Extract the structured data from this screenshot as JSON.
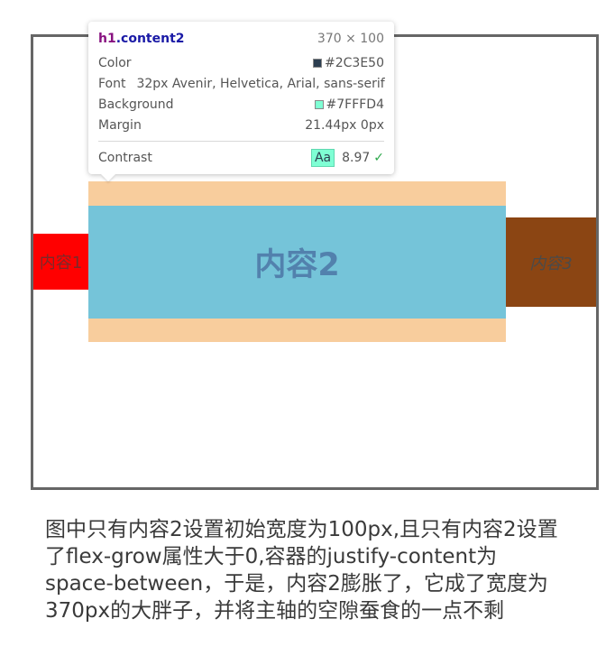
{
  "demo": {
    "item1": {
      "label": "内容1",
      "background": "#FF0000"
    },
    "item2": {
      "label": "内容2",
      "background": "#75C4D9",
      "margin_color": "#F8CD9D"
    },
    "item3": {
      "label": "内容3",
      "background": "#8B4513"
    }
  },
  "tooltip": {
    "selector_tag": "h1",
    "selector_class": ".content2",
    "dimensions": "370 × 100",
    "rows": {
      "color": {
        "label": "Color",
        "value": "#2C3E50",
        "swatch": "#2C3E50"
      },
      "font": {
        "label": "Font",
        "value": "32px Avenir, Helvetica, Arial, sans-serif"
      },
      "background": {
        "label": "Background",
        "value": "#7FFFD4",
        "swatch": "#7FFFD4"
      },
      "margin": {
        "label": "Margin",
        "value": "21.44px 0px"
      },
      "contrast": {
        "label": "Contrast",
        "badge": "Aa",
        "value": "8.97",
        "check": "✓"
      }
    }
  },
  "caption": {
    "lines": [
      "图中只有内容2设置初始宽度为100px,且只有内容2设置",
      "了flex-grow属性大于0,容器的justify-content为",
      "space-between，于是，内容2膨胀了，它成了宽度为",
      "370px的大胖子，并将主轴的空隙蚕食的一点不剩"
    ]
  }
}
